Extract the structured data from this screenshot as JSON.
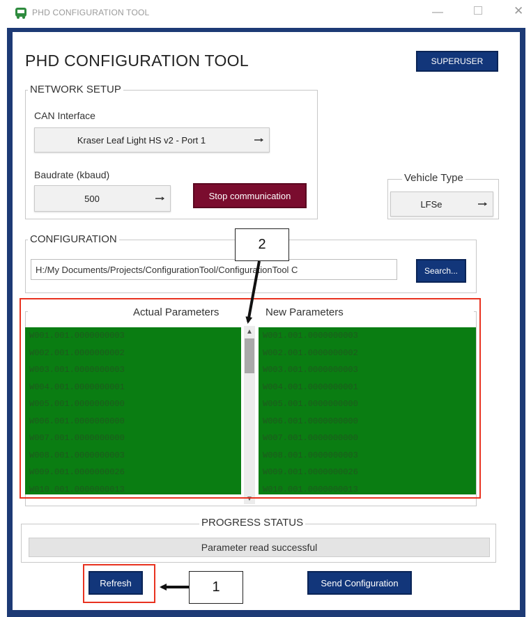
{
  "window": {
    "title": "PHD CONFIGURATION TOOL",
    "minimize_glyph": "—",
    "close_glyph": "✕",
    "frame_color": "#1d3a75",
    "icon": "bus-icon"
  },
  "header": {
    "title": "PHD CONFIGURATION TOOL",
    "superuser_label": "SUPERUSER"
  },
  "network_setup": {
    "legend": "NETWORK SETUP",
    "can_interface_label": "CAN Interface",
    "can_interface_value": "Kraser Leaf Light HS v2 - Port 1",
    "baudrate_label": "Baudrate (kbaud)",
    "baudrate_value": "500",
    "stop_button_label": "Stop communication",
    "stop_button_color": "#7a0c2e"
  },
  "vehicle_type": {
    "legend": "Vehicle Type",
    "value": "LFSe"
  },
  "configuration": {
    "legend": "CONFIGURATION",
    "path": "H:/My Documents/Projects/ConfigurationTool/ConfigurationTool C",
    "search_label": "Search..."
  },
  "parameters": {
    "actual_header": "Actual Parameters",
    "new_header": "New Parameters",
    "list_color": "#0a7d12",
    "actual_rows": [
      "W001.001.0000000003",
      "W002.001.0000000002",
      "W003.001.0000000003",
      "W004.001.0000000001",
      "W005.001.0000000000",
      "W006.001.0000000000",
      "W007.001.0000000000",
      "W008.001.0000000003",
      "W009.001.0000000026",
      "W010.001.0000000013"
    ],
    "new_rows": [
      "W001.001.0000000003",
      "W002.001.0000000002",
      "W003.001.0000000003",
      "W004.001.0000000001",
      "W005.001.0000000000",
      "W006.001.0000000000",
      "W007.001.0000000000",
      "W008.001.0000000003",
      "W009.001.0000000026",
      "W010.001.0000000013"
    ]
  },
  "progress": {
    "legend": "PROGRESS STATUS",
    "status": "Parameter read successful"
  },
  "footer": {
    "refresh_label": "Refresh",
    "send_label": "Send Configuration"
  },
  "callouts": {
    "one": "1",
    "two": "2",
    "highlight_color": "#e8321f"
  }
}
